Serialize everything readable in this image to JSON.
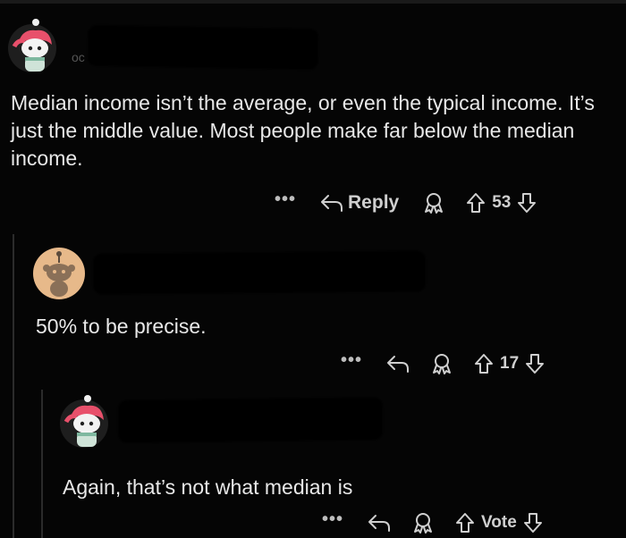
{
  "comments": [
    {
      "username_fragment": "oc",
      "text": "Median income isn’t the average, or even the typical income. It’s just the middle value. Most people make far below the median income.",
      "more_label": "•••",
      "reply_label": "Reply",
      "vote_count": "53"
    },
    {
      "text": "50% to be precise.",
      "more_label": "•••",
      "vote_count": "17"
    },
    {
      "text": "Again, that’s not what median is",
      "more_label": "•••",
      "vote_count": "Vote"
    }
  ],
  "colors": {
    "background": "#050505",
    "avatar_hair": "#e8506b",
    "avatar_tan_bg": "#e7b98a"
  }
}
